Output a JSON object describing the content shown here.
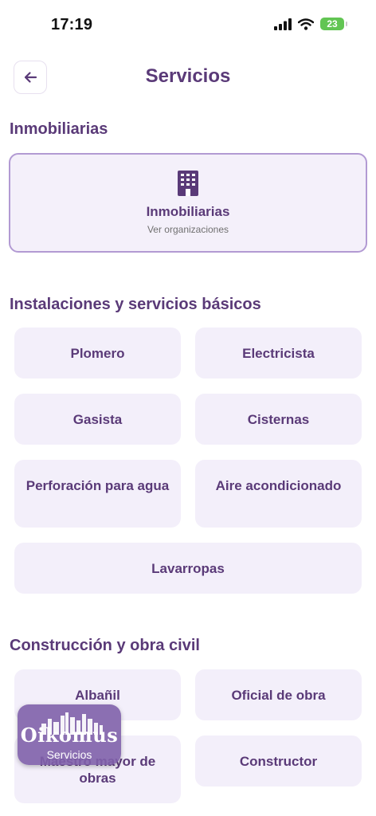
{
  "status_bar": {
    "time": "17:19",
    "battery": "23"
  },
  "header": {
    "title": "Servicios"
  },
  "sections": {
    "inmobiliarias": {
      "title": "Inmobiliarias",
      "card_title": "Inmobiliarias",
      "card_subtitle": "Ver organizaciones"
    },
    "instalaciones": {
      "title": "Instalaciones y servicios básicos",
      "items": [
        "Plomero",
        "Electricista",
        "Gasista",
        "Cisternas",
        "Perforación para agua",
        "Aire acondicionado",
        "Lavarropas"
      ]
    },
    "construccion": {
      "title": "Construcción y obra civil",
      "items": [
        "Albañil",
        "Oficial de obra",
        "Maestro mayor de obras",
        "Constructor"
      ]
    }
  },
  "fab": {
    "logo_text": "Oikomus",
    "label": "Servicios"
  },
  "icons": {
    "back": "arrow-left-icon",
    "building": "building-icon",
    "signal": "cellular-signal-icon",
    "wifi": "wifi-icon",
    "battery": "battery-icon"
  },
  "colors": {
    "primary": "#5a3a78",
    "tile_bg": "#f3effa",
    "card_border": "#b29ad3",
    "battery": "#62c553"
  }
}
